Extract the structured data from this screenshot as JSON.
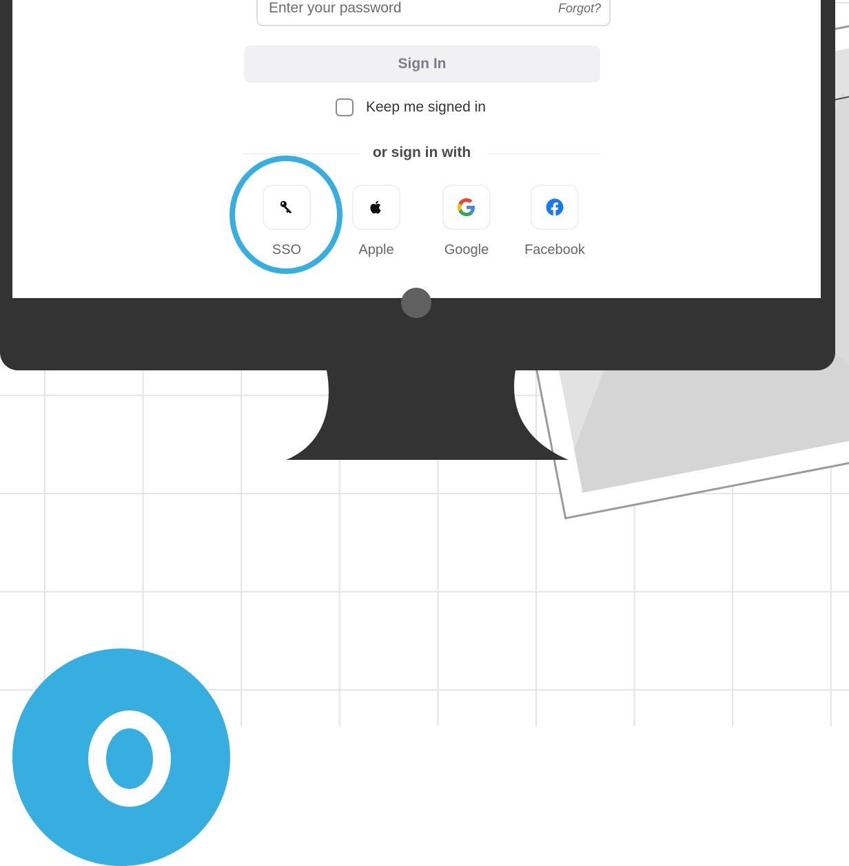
{
  "login": {
    "password_placeholder": "Enter your password",
    "forgot_label": "Forgot?",
    "signin_label": "Sign In",
    "keep_signed_in_label": "Keep me signed in",
    "divider_text": "or sign in with"
  },
  "providers": [
    {
      "label": "SSO",
      "icon": "key-icon"
    },
    {
      "label": "Apple",
      "icon": "apple-icon"
    },
    {
      "label": "Google",
      "icon": "google-icon"
    },
    {
      "label": "Facebook",
      "icon": "facebook-icon"
    }
  ],
  "colors": {
    "highlight": "#36aee0",
    "monitor": "#333333",
    "google_blue": "#4285F4",
    "google_red": "#EA4335",
    "google_yellow": "#FBBC05",
    "google_green": "#34A853",
    "facebook_blue": "#1877F2"
  }
}
